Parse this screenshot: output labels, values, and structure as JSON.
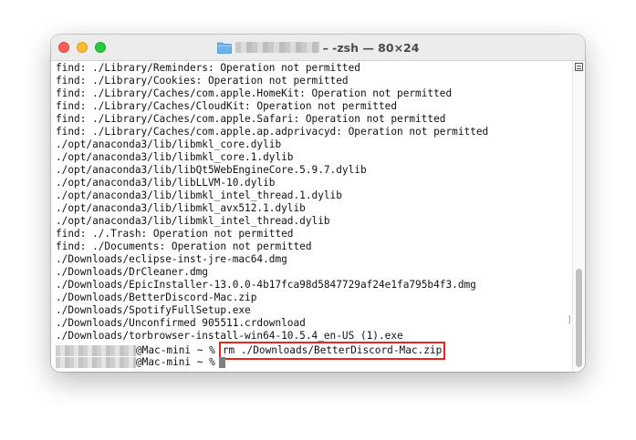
{
  "window": {
    "title_suffix": "– -zsh — 80×24",
    "lines": [
      "find: ./Library/Reminders: Operation not permitted",
      "find: ./Library/Cookies: Operation not permitted",
      "find: ./Library/Caches/com.apple.HomeKit: Operation not permitted",
      "find: ./Library/Caches/CloudKit: Operation not permitted",
      "find: ./Library/Caches/com.apple.Safari: Operation not permitted",
      "find: ./Library/Caches/com.apple.ap.adprivacyd: Operation not permitted",
      "./opt/anaconda3/lib/libmkl_core.dylib",
      "./opt/anaconda3/lib/libmkl_core.1.dylib",
      "./opt/anaconda3/lib/libQt5WebEngineCore.5.9.7.dylib",
      "./opt/anaconda3/lib/libLLVM-10.dylib",
      "./opt/anaconda3/lib/libmkl_intel_thread.1.dylib",
      "./opt/anaconda3/lib/libmkl_avx512.1.dylib",
      "./opt/anaconda3/lib/libmkl_intel_thread.dylib",
      "find: ./.Trash: Operation not permitted",
      "find: ./Documents: Operation not permitted",
      "./Downloads/eclipse-inst-jre-mac64.dmg",
      "./Downloads/DrCleaner.dmg",
      "./Downloads/EpicInstaller-13.0.0-4b17fca98d5847729af24e1fa795b4f3.dmg",
      "./Downloads/BetterDiscord-Mac.zip",
      "./Downloads/SpotifyFullSetup.exe",
      "./Downloads/Unconfirmed 905511.crdownload",
      "./Downloads/torbrowser-install-win64-10.5.4_en-US (1).exe"
    ],
    "prompt_suffix": "@Mac-mini ~ %",
    "command": "rm ./Downloads/BetterDiscord-Mac.zip",
    "prompt2_suffix": "@Mac-mini ~ %"
  }
}
